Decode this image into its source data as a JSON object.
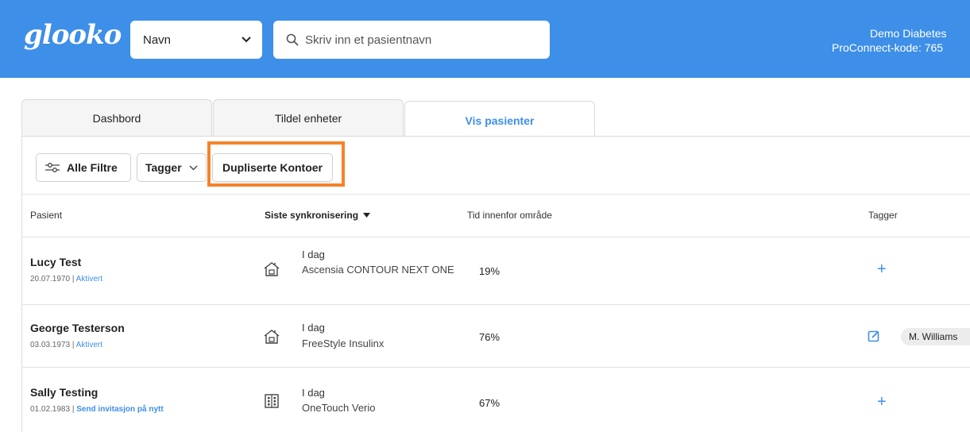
{
  "header": {
    "logo": "glooko",
    "select_value": "Navn",
    "search_placeholder": "Skriv inn et pasientnavn",
    "account_name": "Demo Diabetes",
    "proconnect": "ProConnect-kode: 765"
  },
  "tabs": [
    {
      "label": "Dashbord"
    },
    {
      "label": "Tildel enheter"
    },
    {
      "label": "Vis pasienter"
    }
  ],
  "filters": {
    "all_filters": "Alle Filtre",
    "tags": "Tagger",
    "duplicates": "Dupliserte Kontoer"
  },
  "table": {
    "headers": {
      "patient": "Pasient",
      "last_sync": "Siste synkronisering",
      "time_in_range": "Tid innenfor område",
      "tags": "Tagger"
    },
    "rows": [
      {
        "name": "Lucy Test",
        "dob": "20.07.1970 | ",
        "status": "Aktivert",
        "sync_day": "I dag",
        "device": "Ascensia CONTOUR NEXT ONE",
        "tir": "19%"
      },
      {
        "name": "George Testerson",
        "dob": "03.03.1973 | ",
        "status": "Aktivert",
        "sync_day": "I dag",
        "device": "FreeStyle Insulinx",
        "tir": "76%",
        "tag": "M. Williams"
      },
      {
        "name": "Sally Testing",
        "dob": "01.02.1983 | ",
        "status": "Send invitasjon på nytt",
        "sync_day": "I dag",
        "device": "OneTouch Verio",
        "tir": "67%"
      }
    ],
    "add_tag_symbol": "+"
  },
  "colors": {
    "brand": "#3d8fe8",
    "highlight": "#f5832a"
  }
}
